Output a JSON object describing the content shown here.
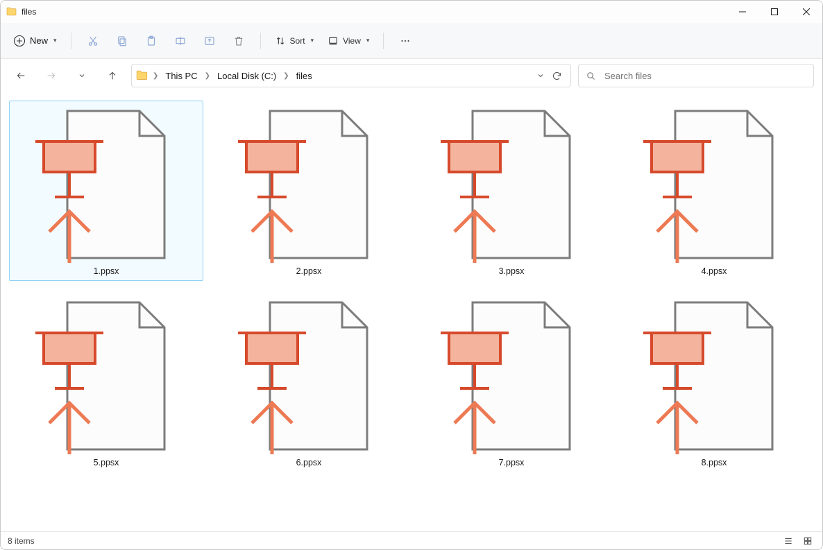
{
  "window": {
    "title": "files"
  },
  "toolbar": {
    "new_label": "New",
    "sort_label": "Sort",
    "view_label": "View"
  },
  "breadcrumbs": {
    "c0": "This PC",
    "c1": "Local Disk (C:)",
    "c2": "files"
  },
  "search": {
    "placeholder": "Search files"
  },
  "files": [
    {
      "name": "1.ppsx",
      "selected": true
    },
    {
      "name": "2.ppsx",
      "selected": false
    },
    {
      "name": "3.ppsx",
      "selected": false
    },
    {
      "name": "4.ppsx",
      "selected": false
    },
    {
      "name": "5.ppsx",
      "selected": false
    },
    {
      "name": "6.ppsx",
      "selected": false
    },
    {
      "name": "7.ppsx",
      "selected": false
    },
    {
      "name": "8.ppsx",
      "selected": false
    }
  ],
  "status": {
    "items_text": "8 items"
  }
}
